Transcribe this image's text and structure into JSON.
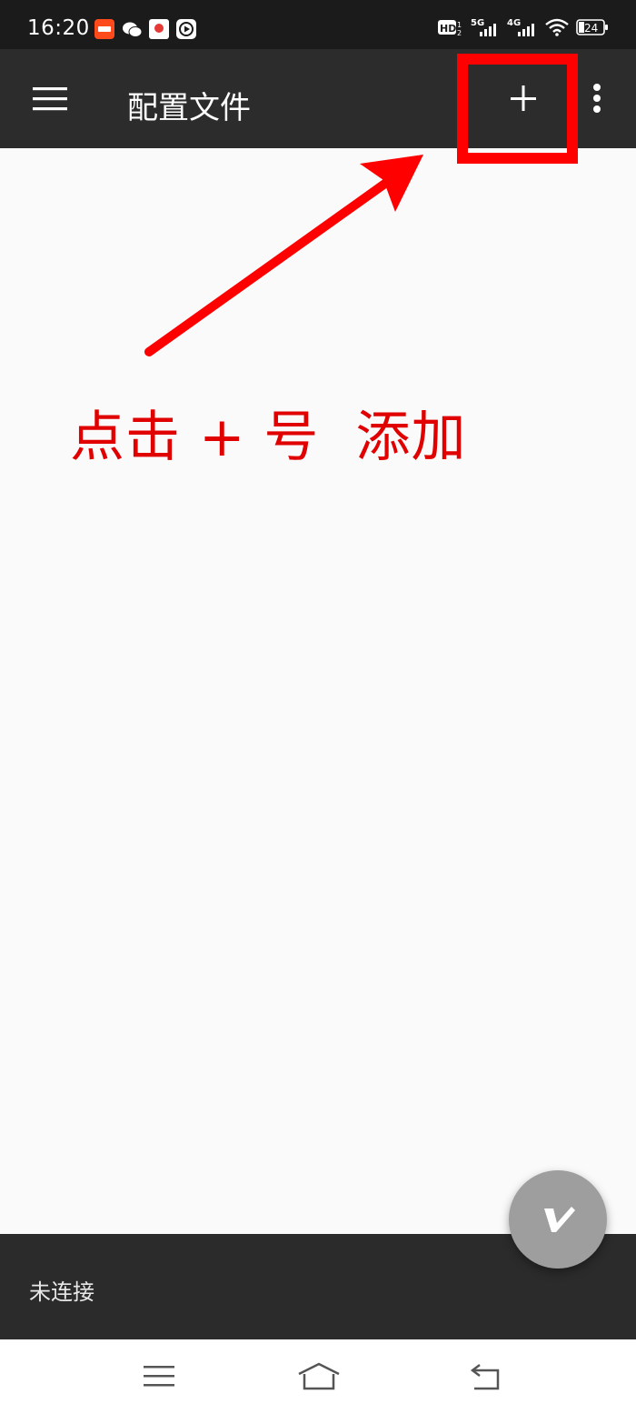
{
  "status_bar": {
    "time": "16:20",
    "battery": "24",
    "signal_labels": [
      "HD",
      "5G",
      "4G"
    ]
  },
  "app_bar": {
    "title": "配置文件",
    "menu_icon": "hamburger-menu-icon",
    "add_icon": "plus-icon",
    "overflow_icon": "more-vert-icon"
  },
  "annotation": {
    "text": "点击 + 号  添加",
    "color": "#e00000"
  },
  "bottom_status": {
    "connection_text": "未连接"
  },
  "fab": {
    "icon": "v-logo-icon"
  },
  "nav_bar": {
    "menu_icon": "nav-menu-icon",
    "home_icon": "nav-home-icon",
    "back_icon": "nav-back-icon"
  }
}
